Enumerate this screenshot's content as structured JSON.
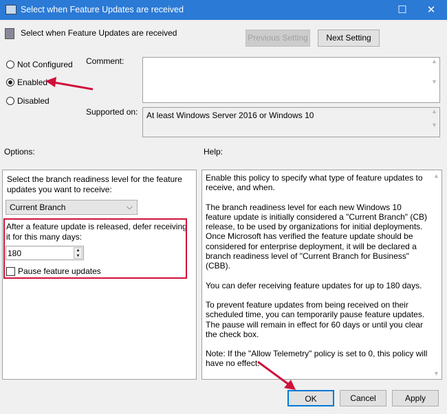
{
  "window": {
    "title": "Select when Feature Updates are received",
    "maximize": "☐",
    "close": "✕"
  },
  "header": {
    "title": "Select when Feature Updates are received",
    "previous": "Previous Setting",
    "next": "Next Setting"
  },
  "state": {
    "options": [
      "Not Configured",
      "Enabled",
      "Disabled"
    ],
    "selected": "Enabled"
  },
  "comment": {
    "label": "Comment:",
    "value": ""
  },
  "supported": {
    "label": "Supported on:",
    "value": "At least Windows Server 2016 or Windows 10"
  },
  "options": {
    "label": "Options:",
    "branch_label": "Select the branch readiness level for the feature updates you want to receive:",
    "branch_value": "Current Branch",
    "defer_label": "After a feature update is released, defer receiving it for this many days:",
    "defer_value": "180",
    "pause_label": "Pause feature updates",
    "pause_checked": false
  },
  "help": {
    "label": "Help:",
    "paragraphs": [
      "Enable this policy to specify what type of feature updates to receive, and when.",
      "The branch readiness level for each new Windows 10 feature update is initially considered a \"Current Branch\" (CB) release, to be used by organizations for initial deployments. Once Microsoft has verified the feature update should be considered for enterprise deployment, it will be declared a branch readiness level of \"Current Branch for Business\" (CBB).",
      "You can defer receiving feature updates for up to 180 days.",
      "To prevent feature updates from being received on their scheduled time, you can temporarily pause feature updates. The pause will remain in effect for 60 days or until you clear the check box.",
      "Note: If the \"Allow Telemetry\" policy is set to 0, this policy will have no effect."
    ]
  },
  "footer": {
    "ok": "OK",
    "cancel": "Cancel",
    "apply": "Apply"
  },
  "colors": {
    "accent": "#2b7ad6",
    "annotation": "#d0103a"
  }
}
